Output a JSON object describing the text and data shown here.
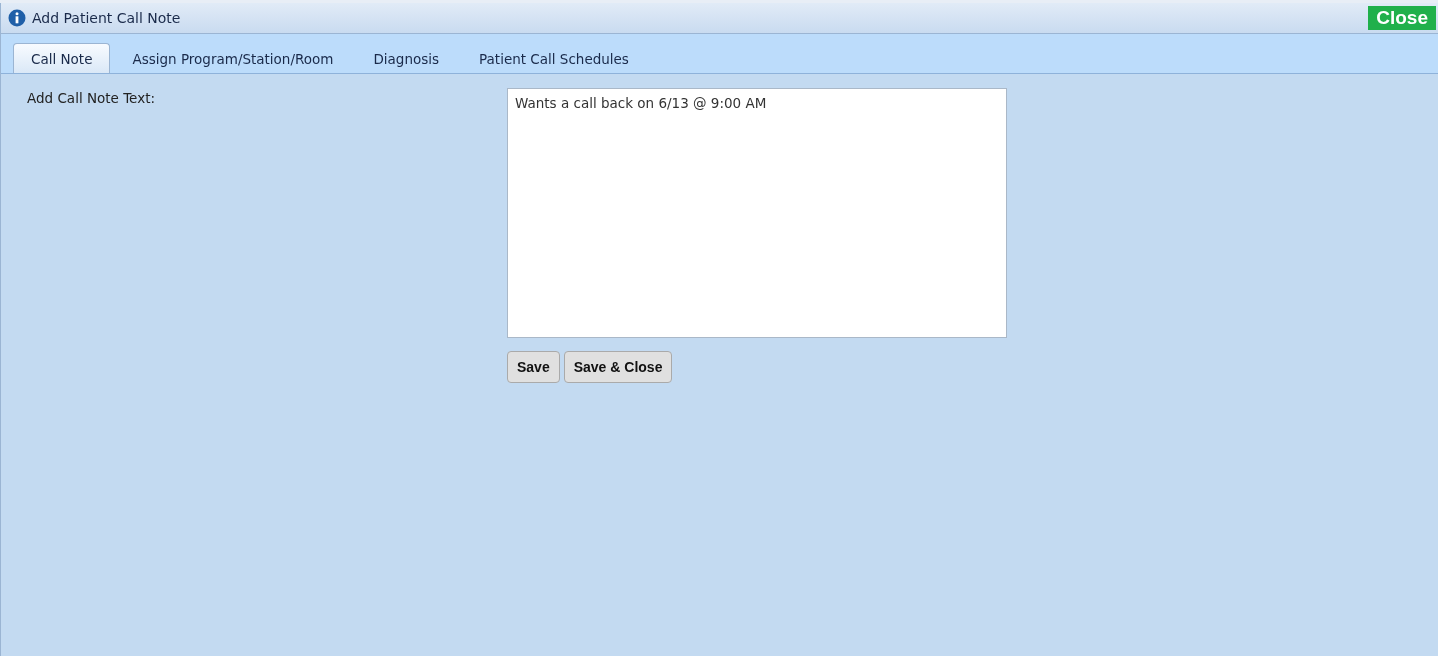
{
  "window": {
    "title": "Add Patient Call Note",
    "close_button": "Close"
  },
  "tabs": [
    {
      "label": "Call Note",
      "selected": true
    },
    {
      "label": "Assign Program/Station/Room",
      "selected": false
    },
    {
      "label": "Diagnosis",
      "selected": false
    },
    {
      "label": "Patient Call Schedules",
      "selected": false
    }
  ],
  "form": {
    "label": "Add Call Note Text:",
    "value": "Wants a call back on 6/13 @ 9:00 AM"
  },
  "buttons": [
    "Save",
    "Save & Close"
  ]
}
